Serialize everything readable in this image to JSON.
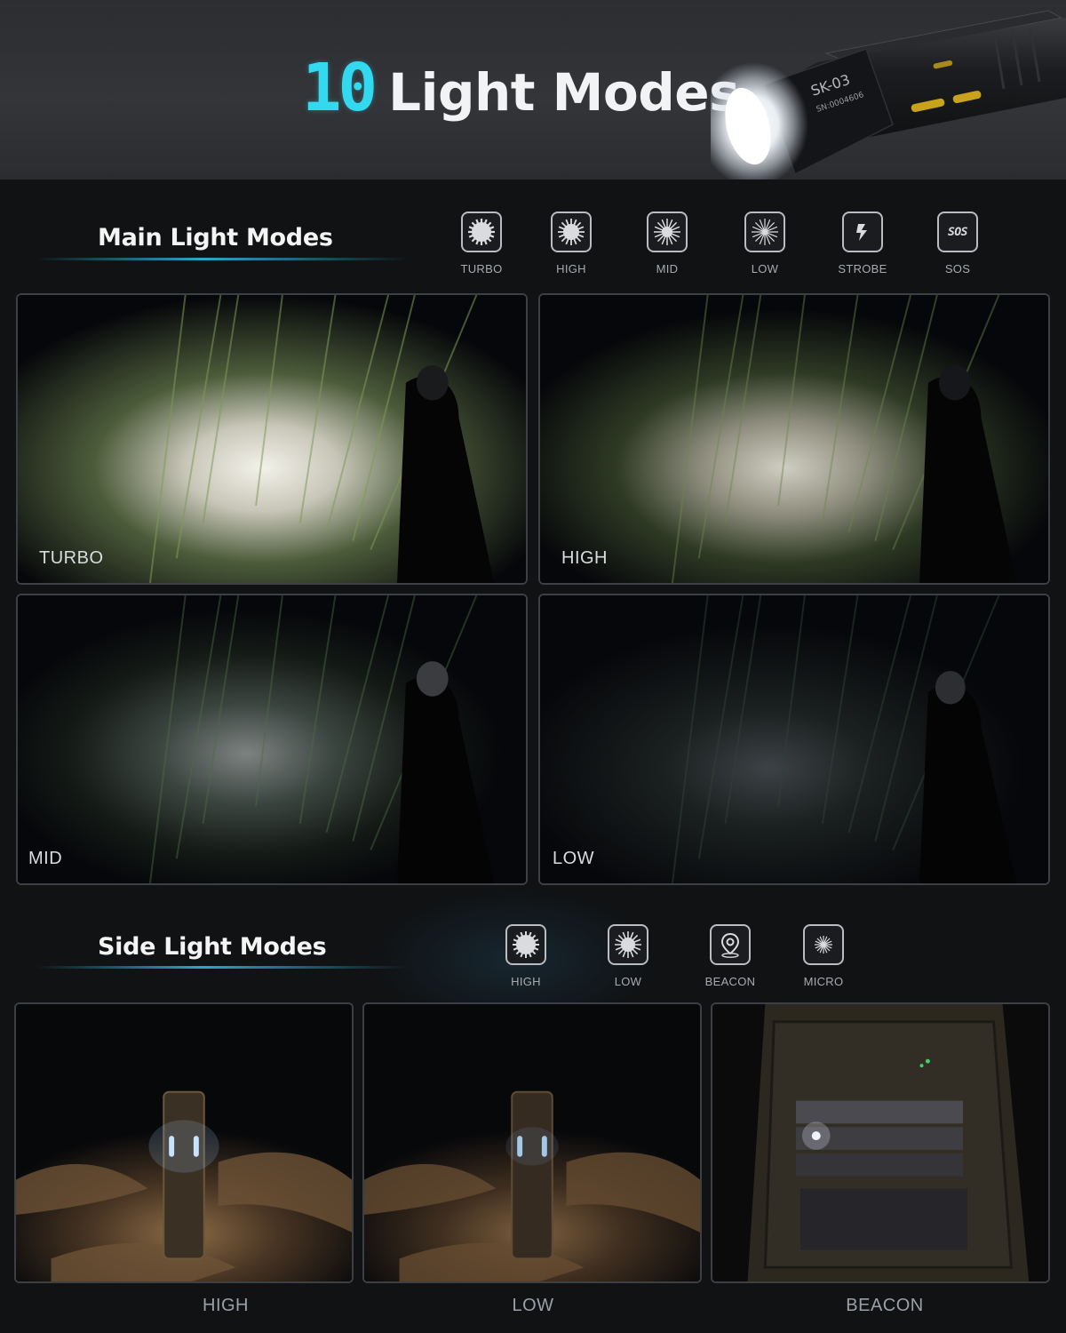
{
  "header": {
    "number": "10",
    "title": "Light Modes",
    "product_model": "SK-03",
    "serial": "SN:0004606"
  },
  "main_section": {
    "title": "Main Light Modes",
    "modes": [
      {
        "label": "TURBO",
        "icon": "sun-full-icon"
      },
      {
        "label": "HIGH",
        "icon": "sun-high-icon"
      },
      {
        "label": "MID",
        "icon": "sun-mid-icon"
      },
      {
        "label": "LOW",
        "icon": "sun-low-icon"
      },
      {
        "label": "STROBE",
        "icon": "lightning-icon"
      },
      {
        "label": "SOS",
        "icon": "sos-icon"
      }
    ],
    "photos": [
      {
        "label": "TURBO",
        "brightness": 1.0
      },
      {
        "label": "HIGH",
        "brightness": 0.72
      },
      {
        "label": "MID",
        "brightness": 0.45
      },
      {
        "label": "LOW",
        "brightness": 0.2
      }
    ]
  },
  "side_section": {
    "title": "Side Light Modes",
    "modes": [
      {
        "label": "HIGH",
        "icon": "sun-high-icon"
      },
      {
        "label": "LOW",
        "icon": "sun-low-icon"
      },
      {
        "label": "BEACON",
        "icon": "location-pin-icon"
      },
      {
        "label": "MICRO",
        "icon": "sun-micro-icon"
      }
    ],
    "photos": [
      {
        "caption": "HIGH"
      },
      {
        "caption": "LOW"
      },
      {
        "caption": "BEACON"
      }
    ]
  },
  "colors": {
    "accent": "#33d9ee",
    "background": "#101214",
    "banner": "#303236"
  }
}
